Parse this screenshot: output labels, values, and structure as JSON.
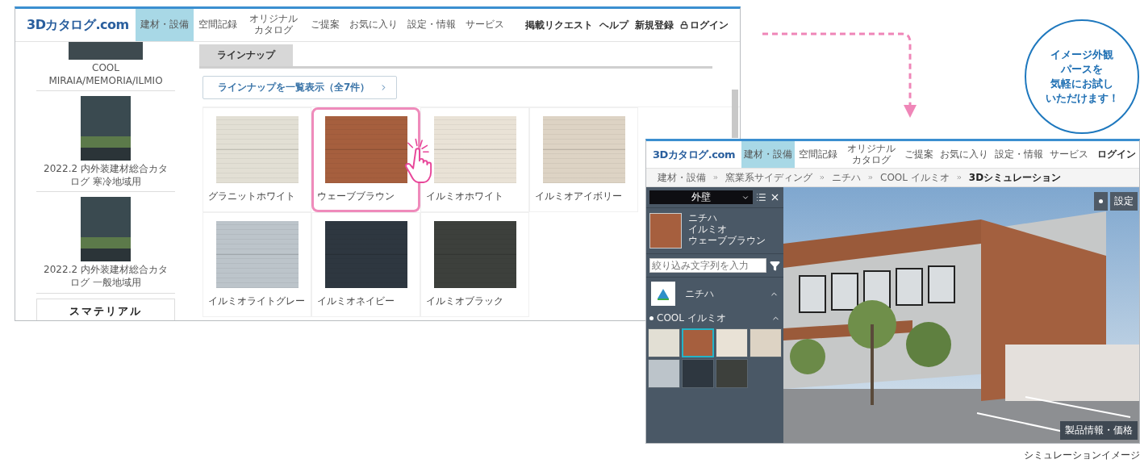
{
  "browse_window": {
    "nav": {
      "logo": "3Dカタログ.com",
      "items": [
        {
          "label": "建材・設備",
          "selected": true
        },
        {
          "label": "空間記録",
          "selected": false
        },
        {
          "label": "オリジナルカタログ",
          "selected": false
        },
        {
          "label": "ご提案",
          "selected": false
        },
        {
          "label": "お気に入り",
          "selected": false
        },
        {
          "label": "設定・情報",
          "selected": false
        },
        {
          "label": "サービス",
          "selected": false
        }
      ],
      "links": [
        "掲載リクエスト",
        "ヘルプ",
        "新規登録"
      ],
      "login": "ログイン"
    },
    "sidebar": {
      "catalogs": [
        {
          "caption": "COOL　MIRAIA/MEMORIA/ILMIO"
        },
        {
          "caption": "2022.2 内外装建材総合カタログ 寒冷地域用"
        },
        {
          "caption": "2022.2 内外装建材総合カタログ 一般地域用"
        }
      ],
      "brand": "スマテリアル"
    },
    "tabs": [
      {
        "label": "ラインナップ",
        "selected": true
      }
    ],
    "lineup_button": "ラインナップを一覧表示（全7件）",
    "products": [
      {
        "name": "グラニットホワイト",
        "color": "#e2dfd4",
        "selected": false
      },
      {
        "name": "ウェーブブラウン",
        "color": "#a65f3e",
        "selected": true
      },
      {
        "name": "イルミオホワイト",
        "color": "#e9e2d6",
        "selected": false
      },
      {
        "name": "イルミオアイボリー",
        "color": "#ddd3c4",
        "selected": false
      },
      {
        "name": "イルミオライトグレー",
        "color": "#bcc4ca",
        "selected": false
      },
      {
        "name": "イルミオネイビー",
        "color": "#2e3740",
        "selected": false
      },
      {
        "name": "イルミオブラック",
        "color": "#3d403c",
        "selected": false
      }
    ]
  },
  "callout": {
    "lines": [
      "イメージ外観",
      "パースを",
      "気軽にお試し",
      "いただけます！"
    ]
  },
  "simulator_window": {
    "nav": {
      "logo": "3Dカタログ.com",
      "items": [
        {
          "label": "建材・設備",
          "selected": true
        },
        {
          "label": "空間記録",
          "selected": false
        },
        {
          "label": "オリジナルカタログ",
          "selected": false
        },
        {
          "label": "ご提案",
          "selected": false
        },
        {
          "label": "お気に入り",
          "selected": false
        },
        {
          "label": "設定・情報",
          "selected": false
        },
        {
          "label": "サービス",
          "selected": false
        }
      ],
      "login": "ログイン"
    },
    "breadcrumb": [
      "建材・設備",
      "窯業系サイディング",
      "ニチハ",
      "COOL イルミオ",
      "3Dシミュレーション"
    ],
    "panel": {
      "category": "外壁",
      "current": [
        "ニチハ",
        "イルミオ",
        "ウェーブブラウン"
      ],
      "search": {
        "placeholder": "絞り込み文字列を入力"
      },
      "maker": "ニチハ",
      "series": "COOL イルミオ",
      "swatches": [
        {
          "color": "#e2dfd4",
          "selected": false
        },
        {
          "color": "#a65f3e",
          "selected": true
        },
        {
          "color": "#e9e2d6",
          "selected": false
        },
        {
          "color": "#ddd3c4",
          "selected": false
        },
        {
          "color": "#bcc4ca",
          "selected": false
        },
        {
          "color": "#2e3740",
          "selected": false
        },
        {
          "color": "#3d403c",
          "selected": false
        }
      ]
    },
    "scene_buttons": [
      "設定"
    ],
    "info_button": "製品情報・価格"
  },
  "caption": "シミュレーションイメージ"
}
